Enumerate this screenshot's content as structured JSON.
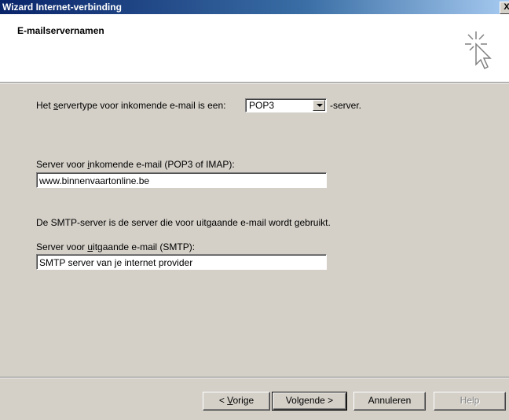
{
  "window": {
    "title": "Wizard Internet-verbinding",
    "close_label": "X"
  },
  "header": {
    "title": "E-mailservernamen",
    "icon": "wizard-cursor-sparkle-icon"
  },
  "form": {
    "server_type_prefix": "Het servertype voor inkomende e-mail is een:",
    "server_type_value": "POP3",
    "server_type_suffix": "-server.",
    "incoming_label": "Server voor inkomende e-mail (POP3 of IMAP):",
    "incoming_value": "www.binnenvaartonline.be",
    "smtp_info": "De SMTP-server is de server die voor uitgaande e-mail wordt gebruikt.",
    "outgoing_label": "Server voor uitgaande e-mail (SMTP):",
    "outgoing_value": "SMTP server van je internet provider"
  },
  "buttons": {
    "back": "< Vorige",
    "next": "Volgende >",
    "cancel": "Annuleren",
    "help": "Help"
  }
}
